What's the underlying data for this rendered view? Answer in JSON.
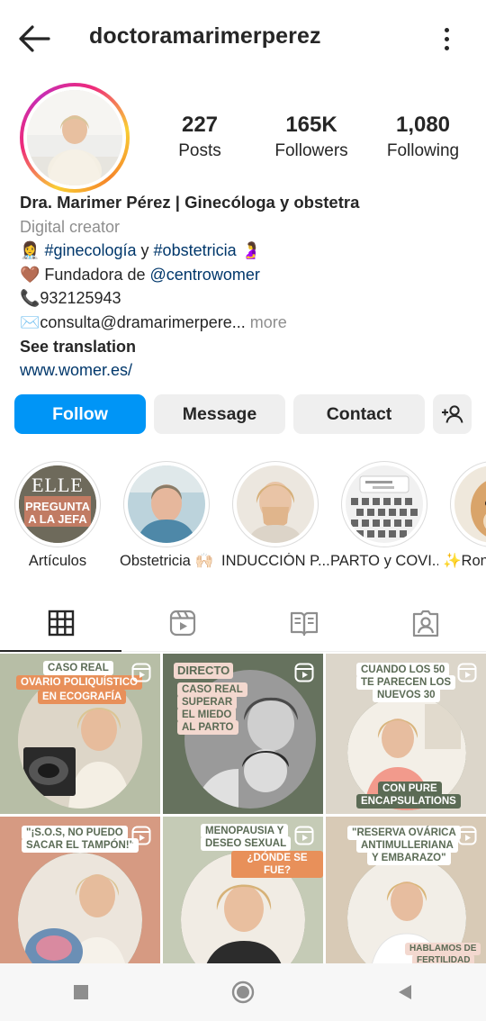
{
  "header": {
    "username": "doctoramarimerperez"
  },
  "stats": [
    {
      "value": "227",
      "label": "Posts"
    },
    {
      "value": "165K",
      "label": "Followers"
    },
    {
      "value": "1,080",
      "label": "Following"
    }
  ],
  "bio": {
    "name": "Dra. Marimer Pérez | Ginecóloga y obstetra",
    "category": "Digital creator",
    "line1": {
      "emoji_a": "👩‍⚕️",
      "tag1": "#ginecología",
      "conj": " y ",
      "tag2": "#obstetricia",
      "emoji_b": "🤰"
    },
    "line2": {
      "emoji": "🤎",
      "text": " Fundadora de ",
      "mention": "@centrowomer"
    },
    "line3": {
      "emoji": "📞",
      "text": "932125943"
    },
    "line4": {
      "emoji": "✉️",
      "text": "consulta@dramarimerpere...",
      "more": " more"
    },
    "see_translation": "See translation",
    "website": "www.womer.es/"
  },
  "buttons": {
    "follow": "Follow",
    "message": "Message",
    "contact": "Contact"
  },
  "highlights": [
    {
      "label": "Artículos",
      "cover_title": "ELLE",
      "cover_text_1": "PREGUNTA",
      "cover_text_2": "A LA JEFA"
    },
    {
      "label": "Obstetricia 🙌🏻"
    },
    {
      "label": "INDUCCIÓN P..."
    },
    {
      "label": "PARTO y COVI..."
    },
    {
      "label": "✨Ron"
    }
  ],
  "posts": [
    {
      "lines": [
        "CASO REAL",
        "OVARIO POLIQUÍSTICO",
        "EN ECOGRAFÍA"
      ]
    },
    {
      "lines": [
        "DIRECTO",
        "CASO REAL",
        "SUPERAR",
        "EL MIEDO",
        "AL PARTO"
      ]
    },
    {
      "lines": [
        "CUANDO LOS 50",
        "TE PARECEN LOS",
        "NUEVOS 30",
        "CON PURE",
        "ENCAPSULATIONS"
      ]
    },
    {
      "lines": [
        "\"¡S.O.S, NO PUEDO",
        "SACAR EL TAMPÓN!\""
      ]
    },
    {
      "lines": [
        "MENOPAUSIA Y",
        "DESEO SEXUAL",
        "¿DÓNDE SE FUE?"
      ]
    },
    {
      "lines": [
        "\"RESERVA OVÁRICA",
        "ANTIMULLERIANA",
        "Y EMBARAZO\"",
        "HABLAMOS DE",
        "FERTILIDAD"
      ]
    }
  ],
  "colors": {
    "follow_blue": "#0095f6",
    "link": "#00376b",
    "post_bg_sage": "#b9c0a8",
    "post_accent": "#5b6b55"
  },
  "icons": {
    "back": "arrow-left-icon",
    "more": "three-dots-vertical-icon",
    "add_user": "person-add-icon",
    "tab_grid": "grid-icon",
    "tab_reels": "reels-icon",
    "tab_guides": "guides-icon",
    "tab_tagged": "tagged-icon"
  }
}
